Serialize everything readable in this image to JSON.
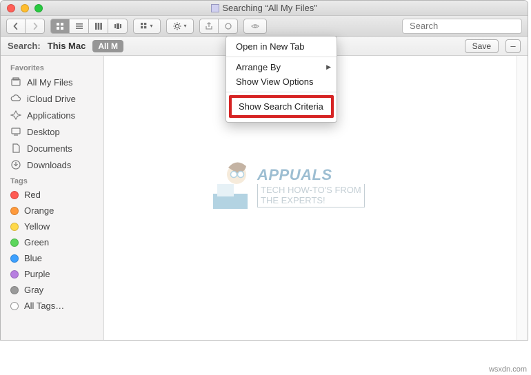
{
  "window": {
    "title": "Searching “All My Files”"
  },
  "toolbar": {
    "search_placeholder": "Search"
  },
  "searchbar": {
    "label": "Search:",
    "scope_thismac": "This Mac",
    "scope_allmy": "All M",
    "save": "Save",
    "minus": "–"
  },
  "sidebar": {
    "favorites_header": "Favorites",
    "favorites": [
      {
        "label": "All My Files"
      },
      {
        "label": "iCloud Drive"
      },
      {
        "label": "Applications"
      },
      {
        "label": "Desktop"
      },
      {
        "label": "Documents"
      },
      {
        "label": "Downloads"
      }
    ],
    "tags_header": "Tags",
    "tags": [
      {
        "label": "Red",
        "color": "#ff5a52"
      },
      {
        "label": "Orange",
        "color": "#ff9a3c"
      },
      {
        "label": "Yellow",
        "color": "#ffd94a"
      },
      {
        "label": "Green",
        "color": "#5bd65b"
      },
      {
        "label": "Blue",
        "color": "#3ca0ff"
      },
      {
        "label": "Purple",
        "color": "#b77ee0"
      },
      {
        "label": "Gray",
        "color": "#9a9a9a"
      }
    ],
    "all_tags": "All Tags…"
  },
  "menu": {
    "open_new_tab": "Open in New Tab",
    "arrange_by": "Arrange By",
    "show_view_options": "Show View Options",
    "show_search_criteria": "Show Search Criteria"
  },
  "watermark": {
    "title": "APPUALS",
    "sub1": "TECH HOW-TO'S FROM",
    "sub2": "THE EXPERTS!"
  },
  "credit": "wsxdn.com"
}
